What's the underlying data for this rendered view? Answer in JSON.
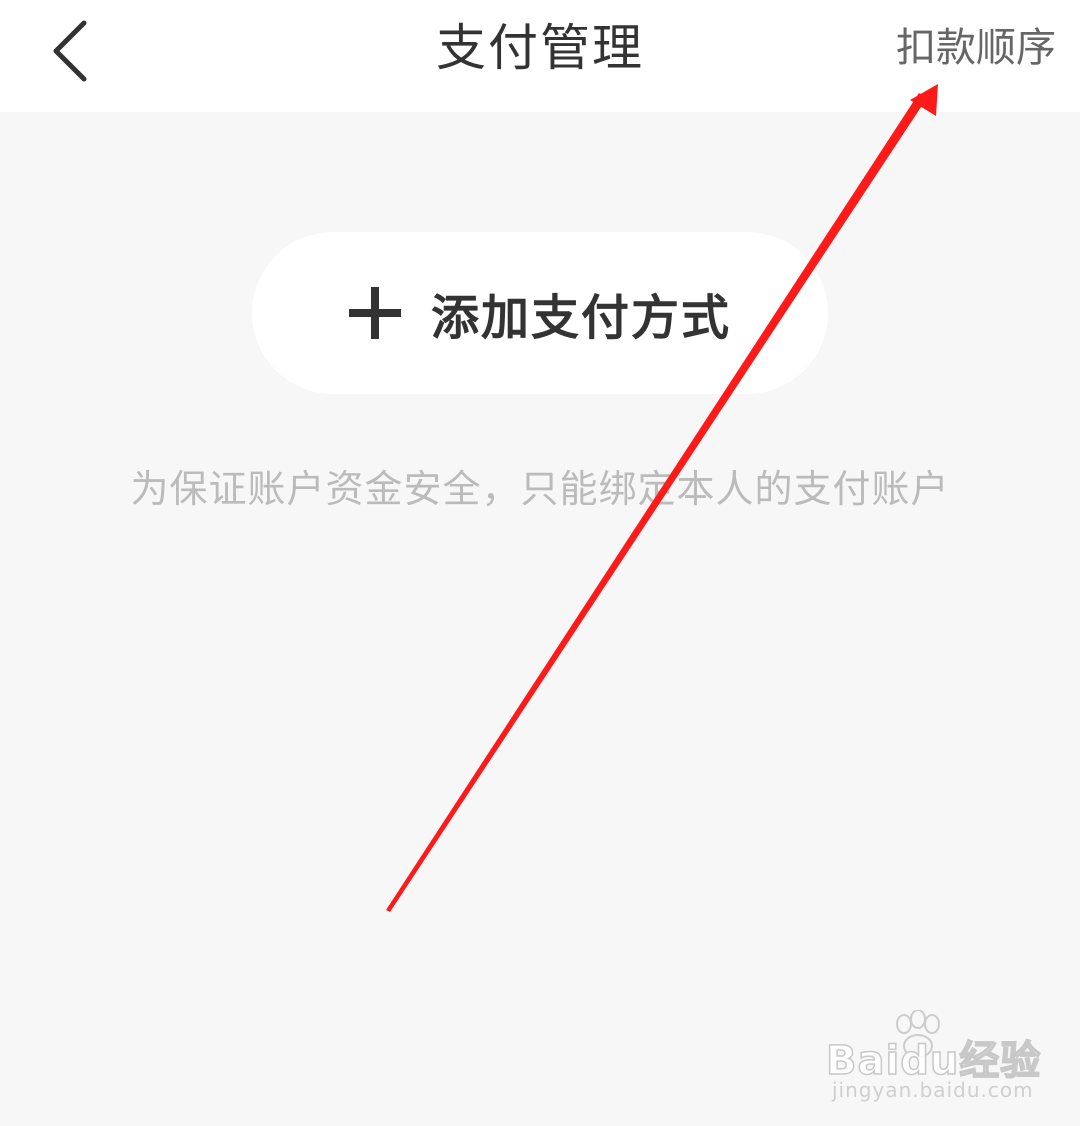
{
  "header": {
    "title": "支付管理",
    "right_action": "扣款顺序",
    "back_icon": "chevron-left-icon"
  },
  "main": {
    "add_button_label": "添加支付方式",
    "add_icon": "plus-icon",
    "hint_text": "为保证账户资金安全，只能绑定本人的支付账户"
  },
  "watermark": {
    "logo_text": "Baidu经验",
    "sub_text": "jingyan.baidu.com"
  },
  "colors": {
    "background": "#f7f7f7",
    "header_bg": "#ffffff",
    "title": "#333333",
    "hint": "#bbbbbb",
    "annotation_arrow": "#ff1a1a"
  }
}
